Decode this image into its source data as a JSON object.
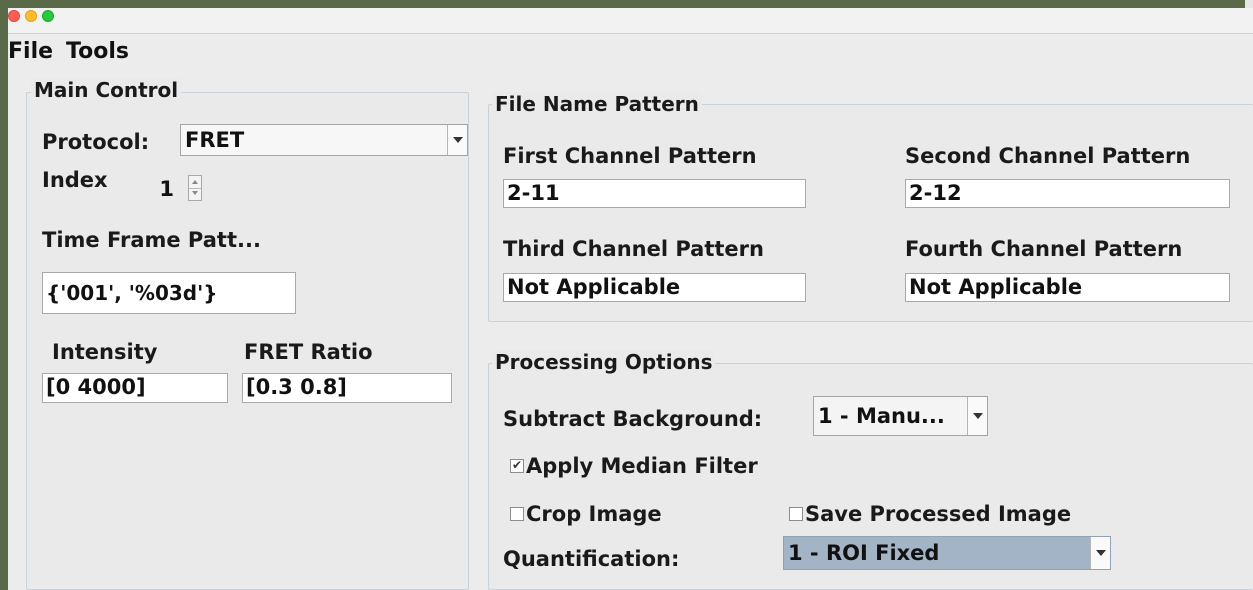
{
  "menu": {
    "file": "File",
    "tools": "Tools"
  },
  "main_control": {
    "title": "Main Control",
    "protocol_label": "Protocol:",
    "protocol_value": "FRET",
    "index_label": "Index",
    "index_value": "1",
    "time_frame_label": "Time Frame Patt...",
    "time_frame_value": "{'001', '%03d'}",
    "intensity_label": "Intensity",
    "intensity_value": "[0 4000]",
    "fret_ratio_label": "FRET Ratio",
    "fret_ratio_value": "[0.3 0.8]"
  },
  "file_name_pattern": {
    "title": "File Name Pattern",
    "first_label": "First Channel Pattern",
    "first_value": "2-11",
    "second_label": "Second Channel Pattern",
    "second_value": "2-12",
    "third_label": "Third Channel Pattern",
    "third_value": "Not Applicable",
    "fourth_label": "Fourth Channel Pattern",
    "fourth_value": "Not Applicable"
  },
  "processing_options": {
    "title": "Processing Options",
    "subtract_background_label": "Subtract Background:",
    "subtract_background_value": "1 - Manu...",
    "apply_median_filter_label": "Apply Median Filter",
    "apply_median_filter_checked": true,
    "crop_image_label": "Crop Image",
    "crop_image_checked": false,
    "save_processed_label": "Save Processed Image",
    "save_processed_checked": false,
    "quantification_label": "Quantification:",
    "quantification_value": "1 - ROI Fixed"
  },
  "colors": {
    "window_bg": "#ececec",
    "selected_combo_bg": "#a3b4c6",
    "panel_border": "#c6d2dc"
  }
}
